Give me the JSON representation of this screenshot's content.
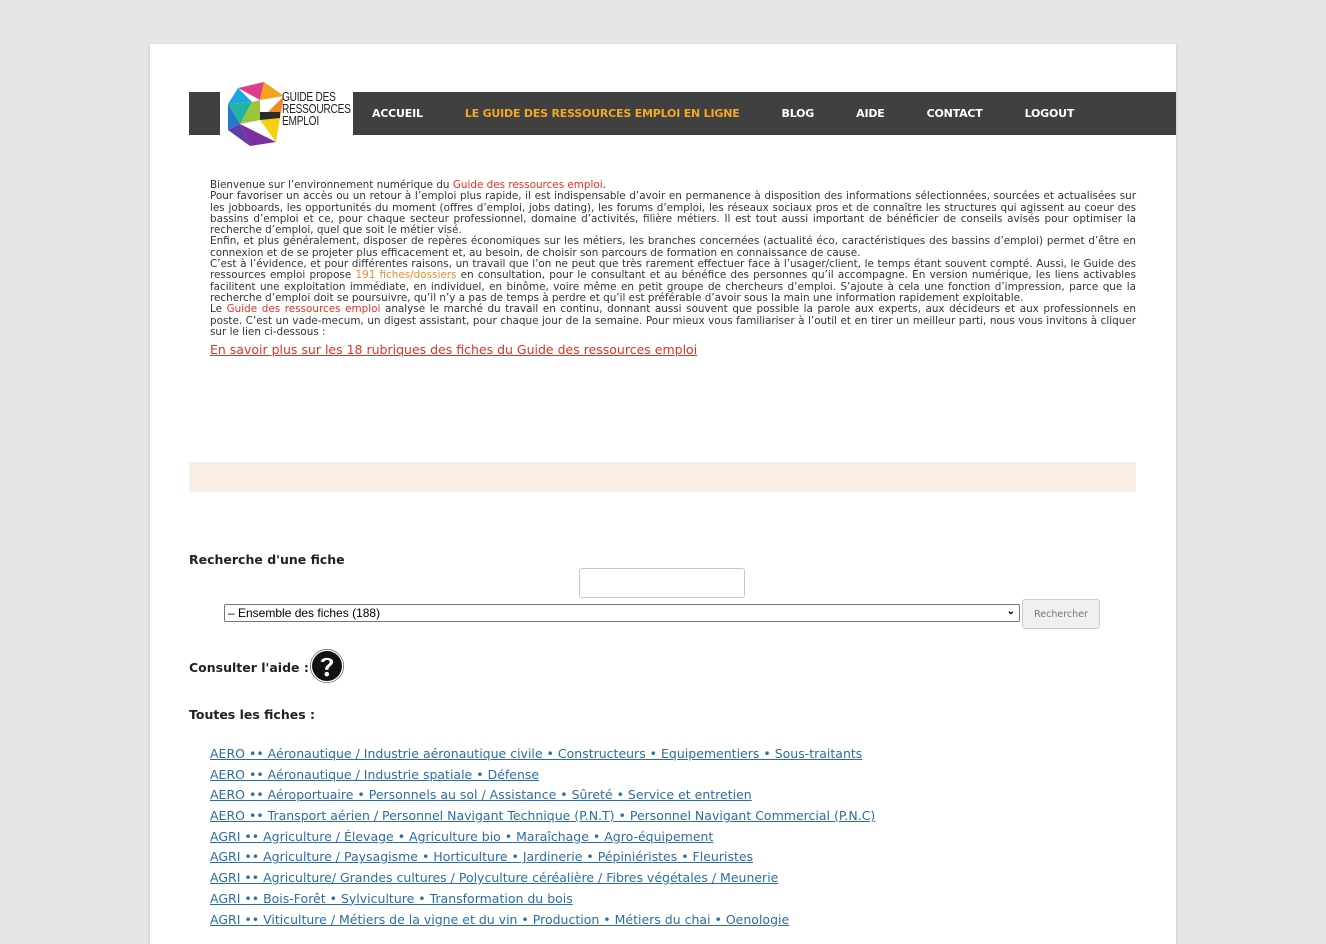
{
  "logo": {
    "lines": [
      "Guide des",
      "ressources",
      "emploi"
    ]
  },
  "nav": [
    {
      "label": "ACCUEIL",
      "active": false
    },
    {
      "label": "LE GUIDE DES RESSOURCES EMPLOI EN LIGNE",
      "active": true
    },
    {
      "label": "BLOG",
      "active": false
    },
    {
      "label": "AIDE",
      "active": false
    },
    {
      "label": "CONTACT",
      "active": false
    },
    {
      "label": "LOGOUT",
      "active": false
    }
  ],
  "intro": {
    "p1_a": "Bienvenue sur l’environnement numérique du ",
    "p1_link": "Guide des ressources emploi",
    "p1_b": ".",
    "p2": "Pour favoriser un accès ou un retour à l’emploi plus rapide, il est indispensable d’avoir en permanence à disposition des informations sélectionnées, sourcées et actualisées sur les jobboards, les opportunités du moment (offres d’emploi, jobs dating), les forums d’emploi, les réseaux sociaux pros et de connaître les structures qui agissent au coeur des bassins d’emploi et ce, pour chaque secteur professionnel, domaine d’activités, filière métiers. Il est tout aussi important de bénéficier de conseils avisés pour optimiser la recherche d’emploi, quel que soit le métier visé.",
    "p3": "Enfin, et plus généralement, disposer de repères économiques sur les métiers, les branches concernées (actualité éco, caractéristiques des bassins d’emploi) permet d’être en connexion et de se projeter plus efficacement et, au besoin, de choisir son parcours de formation en connaissance de cause.",
    "p4_a": "C’est à l’évidence, et pour différentes raisons, un travail que l’on ne peut que très rarement effectuer face à l’usager/client, le temps étant souvent compté. Aussi, le Guide des ressources emploi propose ",
    "p4_link": "191 fiches/dossiers",
    "p4_b": " en consultation, pour le consultant et au bénéfice des personnes qu’il accompagne. En version numérique, les liens activables facilitent une exploitation immédiate, en individuel, en binôme, voire même en petit groupe de chercheurs d’emploi. S’ajoute à cela une fonction d’impression, parce que la recherche d’emploi doit se poursuivre, qu’il n’y a pas de temps à perdre et qu’il est préférable d’avoir sous la main une information rapidement exploitable.",
    "p5_a": "Le ",
    "p5_link": "Guide des ressources emploi",
    "p5_b": " analyse le marché du travail en continu, donnant aussi souvent que possible la parole aux experts, aux décideurs et aux professionnels en poste. C’est un vade-mecum, un digest assistant, pour chaque jour de la semaine. Pour mieux vous familiariser à l’outil et en tirer un meilleur parti, nous vous invitons à cliquer sur le lien ci-dessous :",
    "more_link": "En savoir plus sur les 18 rubriques des fiches du Guide des ressources emploi"
  },
  "search": {
    "title": "Recherche d'une fiche",
    "input_value": "",
    "select_value": "– Ensemble des fiches  (188)",
    "button": "Rechercher"
  },
  "help": {
    "label": "Consulter l'aide :",
    "icon": "question-circle-icon"
  },
  "all_fiches": {
    "title": "Toutes les fiches :",
    "items": [
      "AERO •• Aéronautique / Industrie aéronautique civile • Constructeurs • Equipementiers • Sous-traitants",
      "AERO •• Aéronautique / Industrie spatiale • Défense",
      "AERO •• Aéroportuaire • Personnels au sol / Assistance • Sûreté • Service et entretien",
      "AERO •• Transport aérien / Personnel Navigant Technique (P.N.T) • Personnel Navigant Commercial (P.N.C)",
      "AGRI •• Agriculture / Élevage • Agriculture bio • Maraîchage • Agro-équipement",
      "AGRI •• Agriculture / Paysagisme • Horticulture • Jardinerie • Pépiniéristes • Fleuristes",
      "AGRI •• Agriculture/ Grandes cultures / Polyculture céréalière / Fibres végétales / Meunerie",
      "AGRI •• Bois-Forêt • Sylviculture • Transformation du bois",
      "AGRI •• Viticulture / Métiers de la vigne et du vin • Production • Métiers du chai • Oenologie"
    ]
  },
  "colors": {
    "navbar": "#404040",
    "active_nav": "#f5a623",
    "link_red": "#e8301f",
    "link_orange": "#f08a24",
    "list_link": "#2a6ea8",
    "beige_band": "#fbeee4"
  }
}
